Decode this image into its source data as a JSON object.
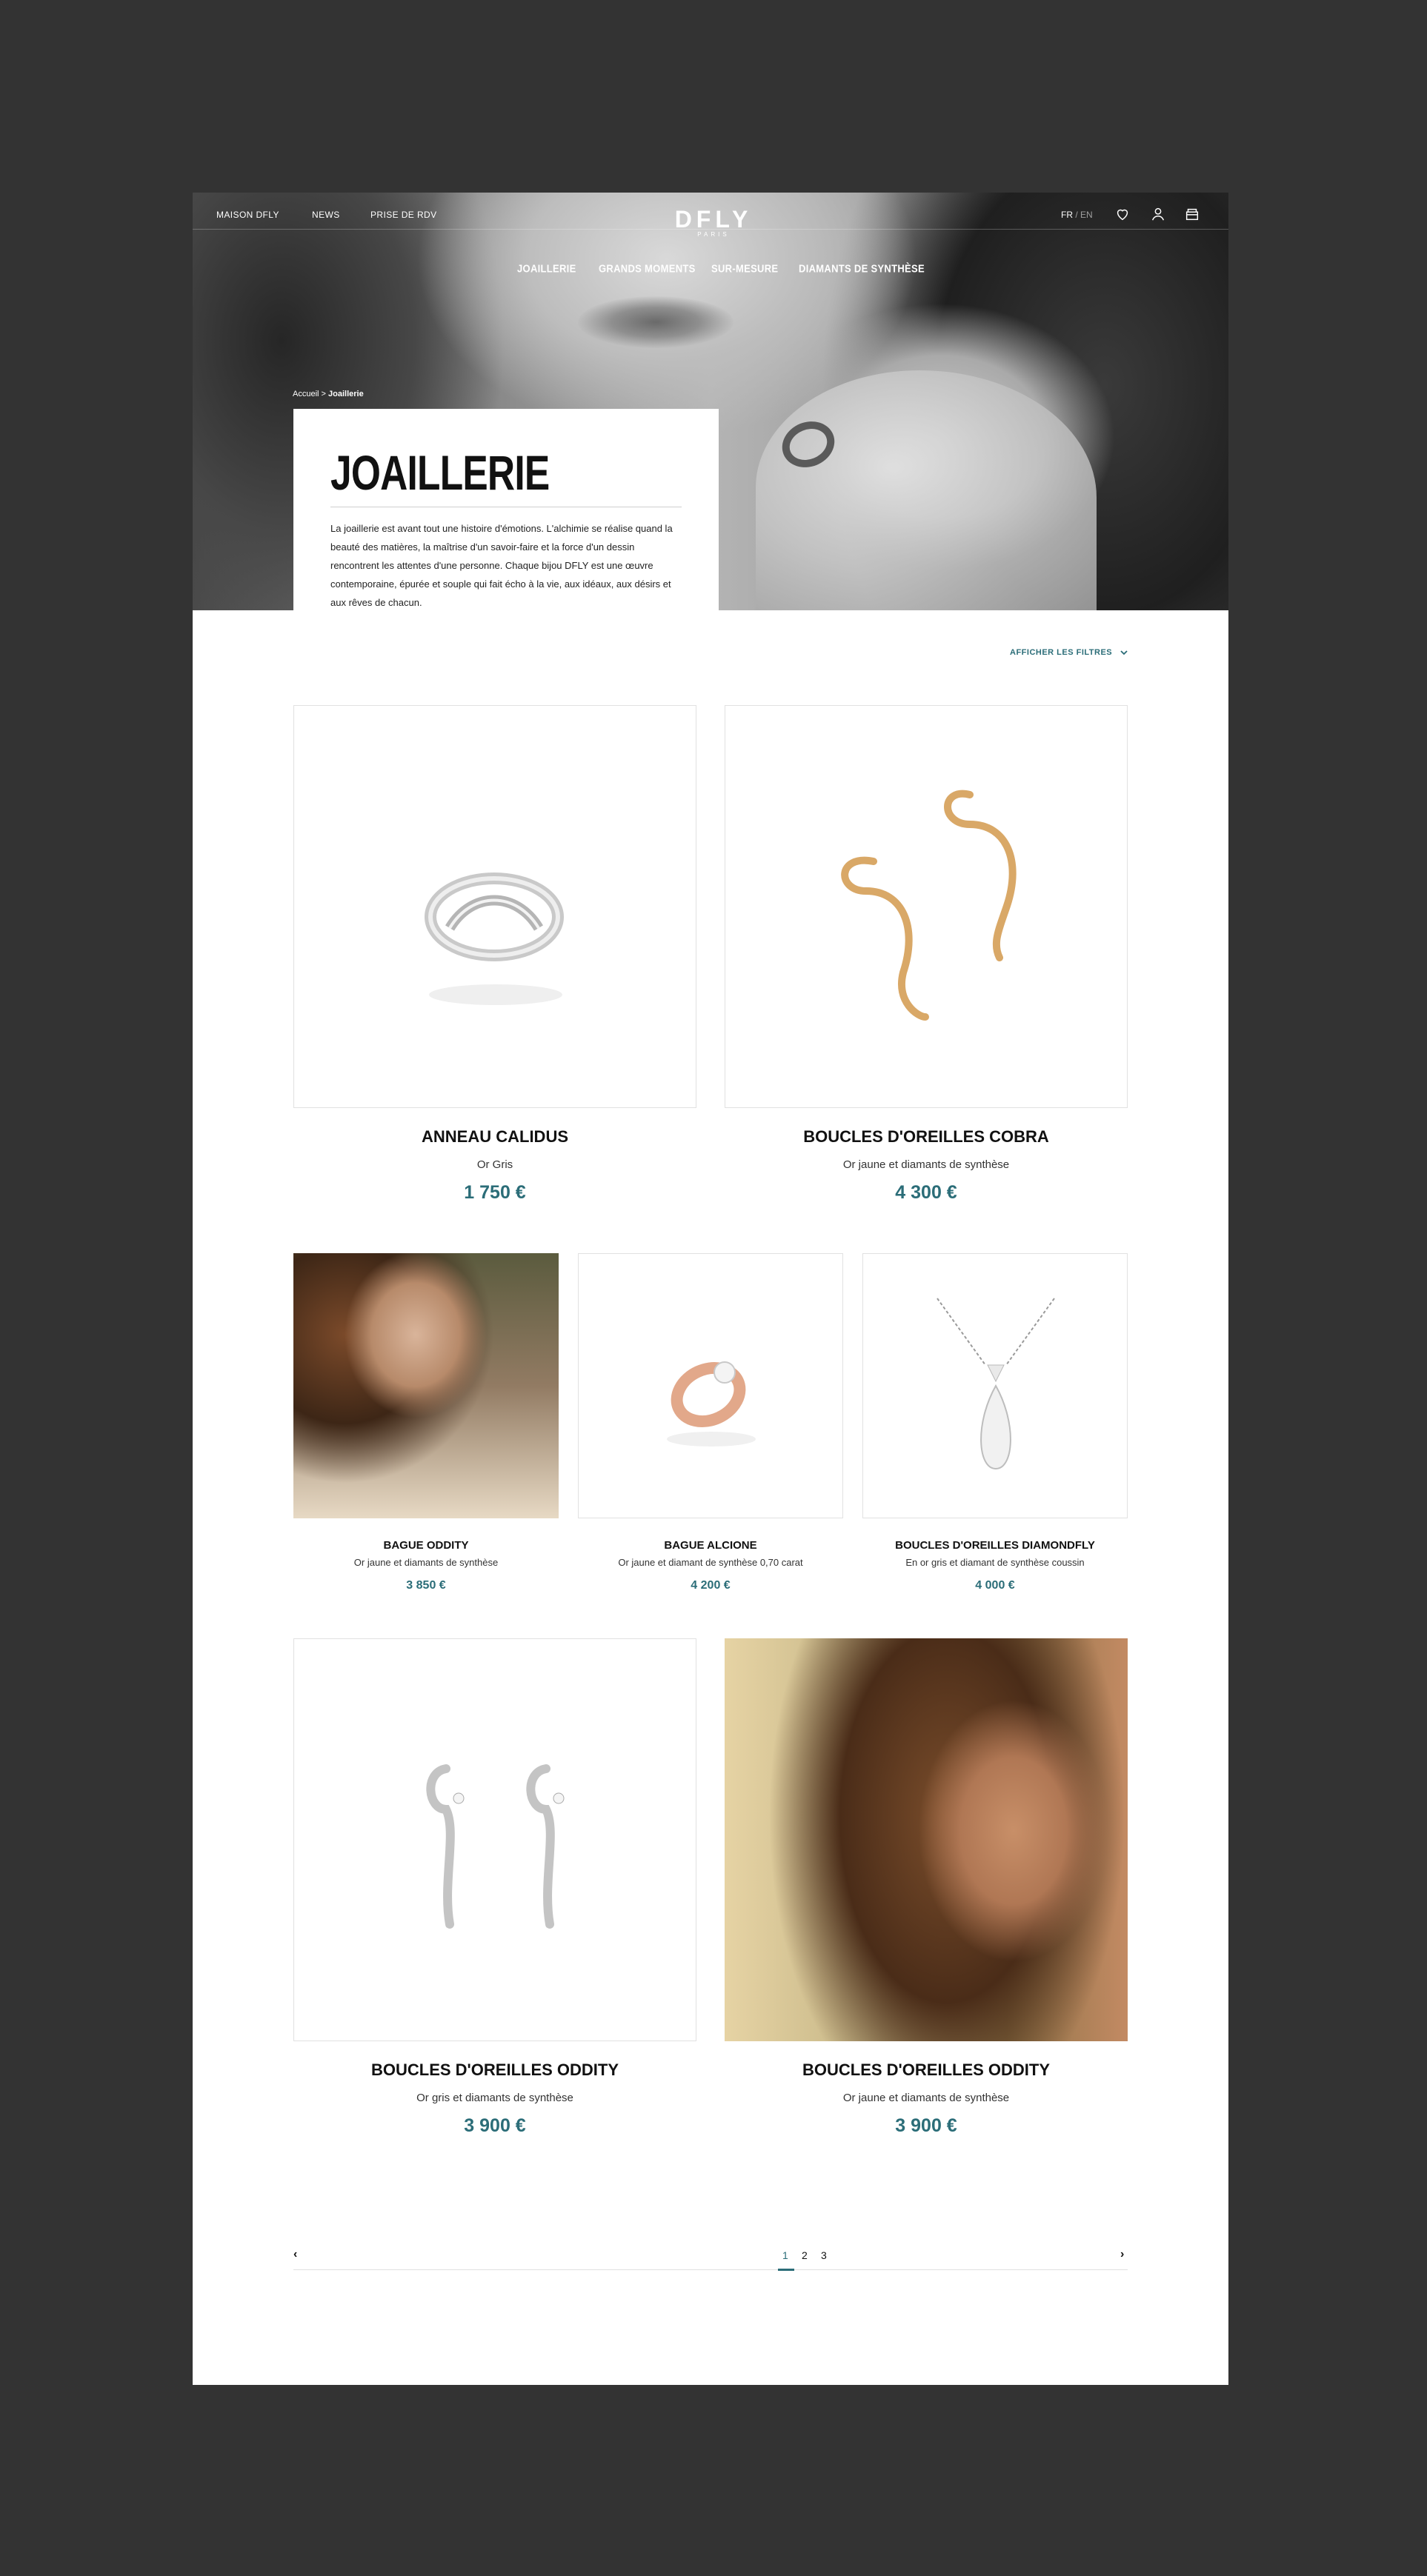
{
  "header": {
    "top_links": [
      "MAISON DFLY",
      "NEWS",
      "PRISE DE RDV"
    ],
    "logo": "DFLY",
    "logo_sub": "PARIS",
    "lang_active": "FR",
    "lang_separator": " / ",
    "lang_other": "EN",
    "icons": [
      "heart-icon",
      "user-icon",
      "bag-icon"
    ],
    "nav": [
      "JOAILLERIE",
      "GRANDS MOMENTS",
      "SUR-MESURE",
      "DIAMANTS DE SYNTHÈSE"
    ]
  },
  "breadcrumb": {
    "home": "Accueil",
    "sep": " > ",
    "current": "Joaillerie"
  },
  "intro": {
    "title": "JOAILLERIE",
    "text": "La joaillerie est avant tout une histoire d'émotions. L'alchimie se réalise quand la beauté des matières, la maîtrise d'un savoir-faire et la force d'un dessin rencontrent les attentes d'une personne. Chaque bijou DFLY est une œuvre contemporaine, épurée et souple qui fait écho à la vie, aux idéaux, aux désirs et aux rêves de chacun."
  },
  "filters": {
    "label": "AFFICHER LES FILTRES",
    "icon": "chevron-down-icon"
  },
  "products": [
    {
      "name": "ANNEAU CALIDUS",
      "material": "Or Gris",
      "price": "1 750 €"
    },
    {
      "name": "BOUCLES D'OREILLES COBRA",
      "material": "Or jaune et diamants de synthèse",
      "price": "4 300 €"
    },
    {
      "name": "BAGUE ODDITY",
      "material": "Or jaune et diamants de synthèse",
      "price": "3 850 €"
    },
    {
      "name": "BAGUE ALCIONE",
      "material": "Or jaune et diamant de synthèse 0,70 carat",
      "price": "4 200 €"
    },
    {
      "name": "BOUCLES D'OREILLES DIAMONDFLY",
      "material": "En or gris et diamant de synthèse coussin",
      "price": "4 000 €"
    },
    {
      "name": "BOUCLES D'OREILLES ODDITY",
      "material": "Or gris et diamants de synthèse",
      "price": "3 900 €"
    },
    {
      "name": "BOUCLES D'OREILLES ODDITY",
      "material": "Or jaune et diamants de synthèse",
      "price": "3 900 €"
    }
  ],
  "pagination": {
    "prev": "‹",
    "pages": [
      "1",
      "2",
      "3"
    ],
    "active": "1",
    "next": "›"
  },
  "colors": {
    "accent": "#2b6d78",
    "backdrop": "#333333"
  }
}
